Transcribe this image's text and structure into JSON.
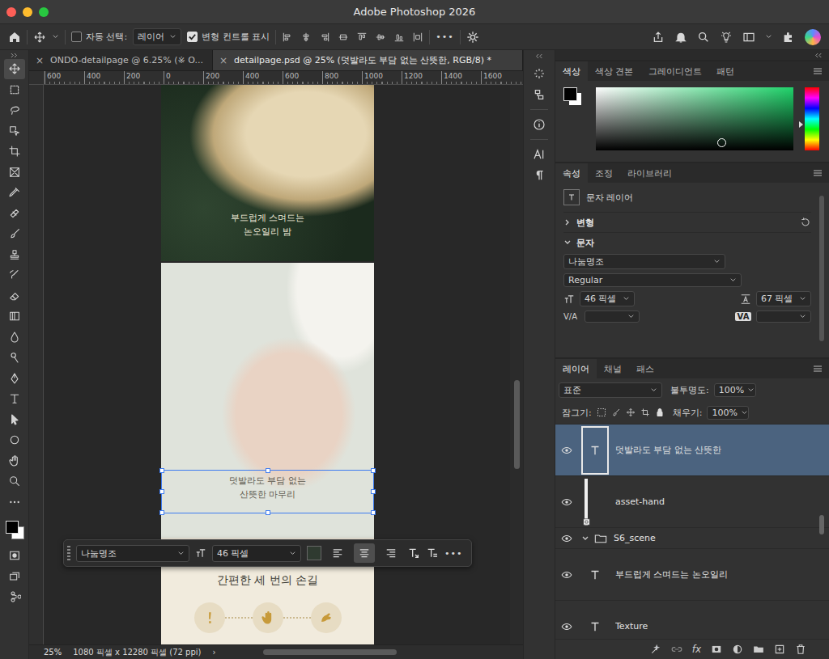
{
  "window": {
    "title": "Adobe Photoshop 2026"
  },
  "options_bar": {
    "auto_select": {
      "label": "자동 선택:",
      "checked": false
    },
    "target": "레이어",
    "show_transform": {
      "label": "변형 컨트롤 표시",
      "checked": true
    },
    "more": "•••"
  },
  "toolbar": {
    "tools": [
      {
        "kind": "move",
        "selected": true
      },
      {
        "kind": "marquee",
        "selected": false
      },
      {
        "kind": "lasso",
        "selected": false
      },
      {
        "kind": "object-select",
        "selected": false
      },
      {
        "kind": "crop",
        "selected": false
      },
      {
        "kind": "frame",
        "selected": false
      },
      {
        "kind": "eyedropper",
        "selected": false
      },
      {
        "kind": "healing",
        "selected": false
      },
      {
        "kind": "brush",
        "selected": false
      },
      {
        "kind": "stamp",
        "selected": false
      },
      {
        "kind": "history",
        "selected": false
      },
      {
        "kind": "eraser",
        "selected": false
      },
      {
        "kind": "gradient",
        "selected": false
      },
      {
        "kind": "blur",
        "selected": false
      },
      {
        "kind": "dodge",
        "selected": false
      },
      {
        "kind": "pen",
        "selected": false
      },
      {
        "kind": "type",
        "selected": false
      },
      {
        "kind": "path-select",
        "selected": false
      },
      {
        "kind": "shape",
        "selected": false
      },
      {
        "kind": "hand",
        "selected": false
      },
      {
        "kind": "zoom",
        "selected": false
      },
      {
        "kind": "more",
        "selected": false
      }
    ]
  },
  "doc_tabs": [
    {
      "label": "ONDO-detailpage @ 6.25% (※ O...",
      "close": "×",
      "selected": false
    },
    {
      "label": "detailpage.psd @ 25% (덧발라도 부담 없는 산뜻한, RGB/8) *",
      "close": "×",
      "selected": true
    }
  ],
  "ruler": [
    "600",
    "400",
    "200",
    "0",
    "200",
    "400",
    "600",
    "800",
    "1000",
    "1200",
    "1400",
    "1600"
  ],
  "canvas": {
    "sections": [
      {
        "kind": "photo-dark",
        "lines": [
          "부드럽게 스며드는",
          "논오일리 밤"
        ],
        "selected": false
      },
      {
        "kind": "photo-light",
        "lines": [
          "덧발라도 부담 없는",
          "산뜻한 마무리"
        ],
        "selected": true
      },
      {
        "kind": "steps",
        "lines": [
          "간편한 세 번의 손길"
        ],
        "selected": false
      }
    ]
  },
  "task_bar": {
    "font": "나눔명조",
    "size": "46 픽셀",
    "color": "#2f3a30",
    "align": [
      {
        "kind": "left",
        "selected": false
      },
      {
        "kind": "center",
        "selected": true
      },
      {
        "kind": "right",
        "selected": false
      }
    ],
    "more": "•••"
  },
  "status_bar": {
    "zoom": "25%",
    "size": "1080 픽셀 x 12280 픽셀 (72 ppi)",
    "arrow": "›"
  },
  "color_panel": {
    "tabs": [
      {
        "label": "색상",
        "selected": true
      },
      {
        "label": "색상 견본",
        "selected": false
      },
      {
        "label": "그레이디언트",
        "selected": false
      },
      {
        "label": "패턴",
        "selected": false
      }
    ]
  },
  "properties": {
    "tabs": [
      {
        "label": "속성",
        "selected": true
      },
      {
        "label": "조정",
        "selected": false
      },
      {
        "label": "라이브러리",
        "selected": false
      }
    ],
    "layer_type": "문자 레이어",
    "sections": [
      {
        "label": "변형",
        "expanded": false
      },
      {
        "label": "문자",
        "expanded": true
      }
    ],
    "font": "나눔명조",
    "style": "Regular",
    "size": "46 픽셀",
    "leading": "67 픽셀",
    "tracking": "V/A",
    "kerning": "VA"
  },
  "layers": {
    "tabs": [
      {
        "label": "레이어",
        "selected": true
      },
      {
        "label": "채널",
        "selected": false
      },
      {
        "label": "패스",
        "selected": false
      }
    ],
    "blend": "표준",
    "opacity_label": "불투명도:",
    "opacity": "100%",
    "lock_label": "잠그기:",
    "fill_label": "채우기:",
    "fill": "100%",
    "items": [
      {
        "name": "덧발라도 부담 없는 산뜻한",
        "kind": "text",
        "visible": true,
        "selected": true,
        "expanded": false
      },
      {
        "name": "asset-hand",
        "kind": "image",
        "visible": true,
        "selected": false,
        "expanded": false
      },
      {
        "name": "S6_scene",
        "kind": "group",
        "visible": true,
        "selected": false,
        "expanded": true
      },
      {
        "name": "부드럽게 스며드는 논오일리",
        "kind": "text",
        "visible": true,
        "selected": false,
        "expanded": false
      },
      {
        "name": "Texture",
        "kind": "text",
        "visible": true,
        "selected": false,
        "expanded": false
      }
    ],
    "footer": {
      "fx": "fx"
    }
  }
}
